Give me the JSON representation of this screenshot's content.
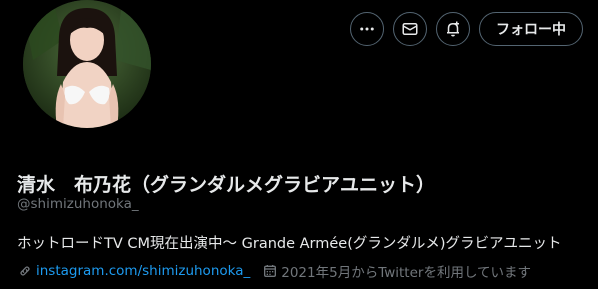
{
  "profile": {
    "display_name": "清水　布乃花（グランダルメグラビアユニット）",
    "handle": "@shimizuhonoka_",
    "bio": "ホットロードTV CM現在出演中〜 Grande Armée(グランダルメ)グラビアユニット",
    "link_text": "instagram.com/shimizuhonoka_",
    "joined_text": "2021年5月からTwitterを利用しています"
  },
  "actions": {
    "more_icon": "more-horizontal-icon",
    "message_icon": "envelope-icon",
    "notify_icon": "bell-plus-icon",
    "follow_label": "フォロー中"
  },
  "icons": {
    "link": "link-icon",
    "calendar": "calendar-icon"
  },
  "colors": {
    "background": "#000000",
    "text_primary": "#e7e9ea",
    "text_secondary": "#71767b",
    "link": "#1d9bf0",
    "button_border": "#536471"
  }
}
